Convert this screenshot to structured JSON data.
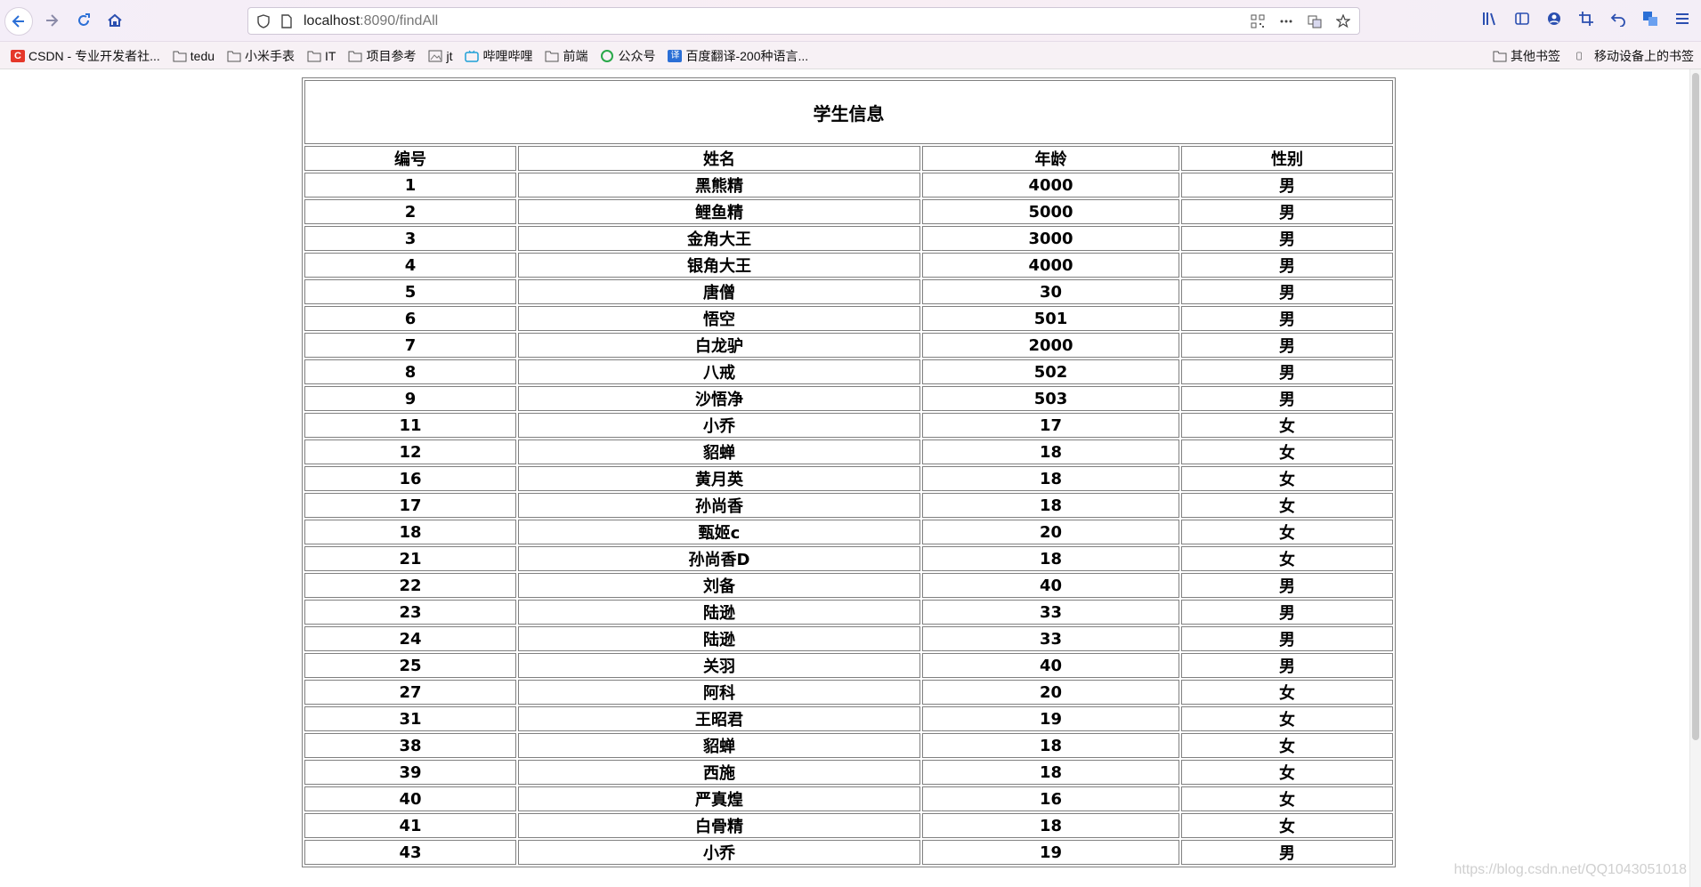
{
  "browser": {
    "url_host": "localhost",
    "url_rest": ":8090/findAll"
  },
  "bookmarks": {
    "items": [
      {
        "label": "CSDN - 专业开发者社...",
        "icon": "csdn-icon"
      },
      {
        "label": "tedu",
        "icon": "folder-icon"
      },
      {
        "label": "小米手表",
        "icon": "folder-icon"
      },
      {
        "label": "IT",
        "icon": "folder-icon"
      },
      {
        "label": "项目参考",
        "icon": "folder-icon"
      },
      {
        "label": "jt",
        "icon": "image-icon"
      },
      {
        "label": "哔哩哔哩",
        "icon": "bilibili-icon"
      },
      {
        "label": "前端",
        "icon": "folder-icon"
      },
      {
        "label": "公众号",
        "icon": "wechat-icon"
      },
      {
        "label": "百度翻译-200种语言...",
        "icon": "translate-icon"
      }
    ],
    "right": [
      {
        "label": "其他书签",
        "icon": "folder-icon"
      },
      {
        "label": "移动设备上的书签",
        "icon": "mobile-icon"
      }
    ]
  },
  "table": {
    "title": "学生信息",
    "headers": [
      "编号",
      "姓名",
      "年龄",
      "性别"
    ],
    "rows": [
      [
        "1",
        "黑熊精",
        "4000",
        "男"
      ],
      [
        "2",
        "鲤鱼精",
        "5000",
        "男"
      ],
      [
        "3",
        "金角大王",
        "3000",
        "男"
      ],
      [
        "4",
        "银角大王",
        "4000",
        "男"
      ],
      [
        "5",
        "唐僧",
        "30",
        "男"
      ],
      [
        "6",
        "悟空",
        "501",
        "男"
      ],
      [
        "7",
        "白龙驴",
        "2000",
        "男"
      ],
      [
        "8",
        "八戒",
        "502",
        "男"
      ],
      [
        "9",
        "沙悟净",
        "503",
        "男"
      ],
      [
        "11",
        "小乔",
        "17",
        "女"
      ],
      [
        "12",
        "貂蝉",
        "18",
        "女"
      ],
      [
        "16",
        "黄月英",
        "18",
        "女"
      ],
      [
        "17",
        "孙尚香",
        "18",
        "女"
      ],
      [
        "18",
        "甄姬c",
        "20",
        "女"
      ],
      [
        "21",
        "孙尚香D",
        "18",
        "女"
      ],
      [
        "22",
        "刘备",
        "40",
        "男"
      ],
      [
        "23",
        "陆逊",
        "33",
        "男"
      ],
      [
        "24",
        "陆逊",
        "33",
        "男"
      ],
      [
        "25",
        "关羽",
        "40",
        "男"
      ],
      [
        "27",
        "阿科",
        "20",
        "女"
      ],
      [
        "31",
        "王昭君",
        "19",
        "女"
      ],
      [
        "38",
        "貂蝉",
        "18",
        "女"
      ],
      [
        "39",
        "西施",
        "18",
        "女"
      ],
      [
        "40",
        "严真煌",
        "16",
        "女"
      ],
      [
        "41",
        "白骨精",
        "18",
        "女"
      ],
      [
        "43",
        "小乔",
        "19",
        "男"
      ]
    ]
  },
  "watermark": "https://blog.csdn.net/QQ1043051018"
}
